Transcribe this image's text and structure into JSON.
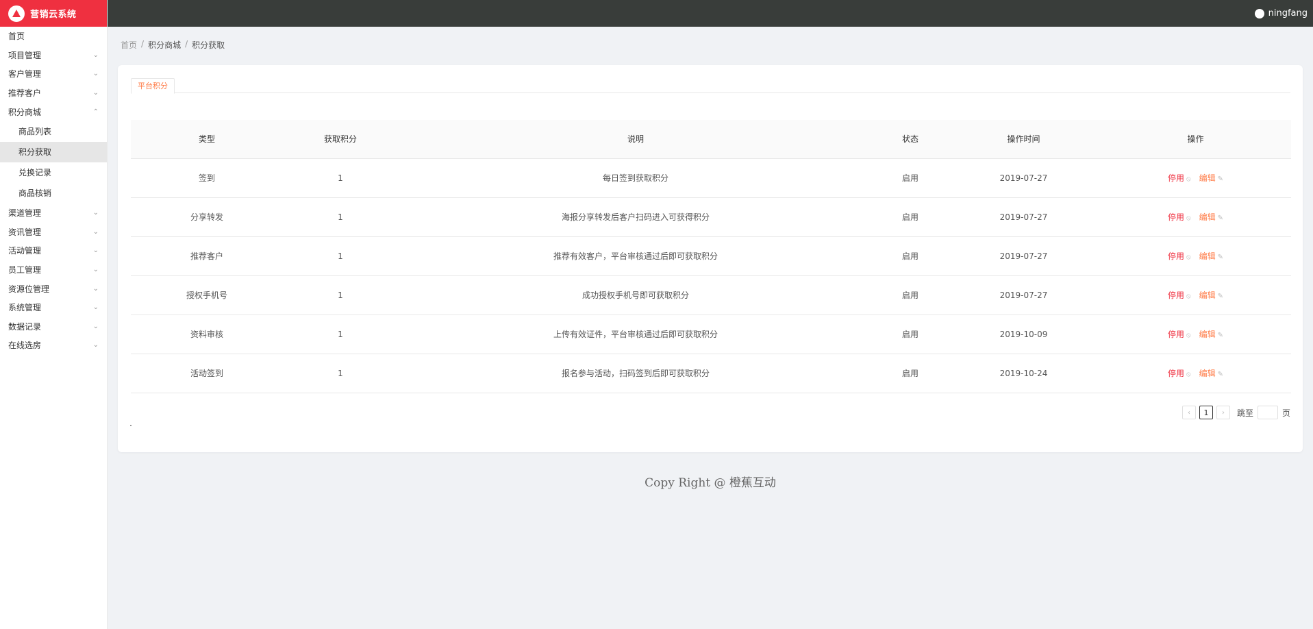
{
  "app": {
    "title": "营销云系统"
  },
  "user": {
    "name": "ningfang"
  },
  "sidebar": {
    "items": [
      {
        "label": "首页",
        "chevron": ""
      },
      {
        "label": "项目管理",
        "chevron": "⌄"
      },
      {
        "label": "客户管理",
        "chevron": "⌄"
      },
      {
        "label": "推荐客户",
        "chevron": "⌄"
      },
      {
        "label": "积分商城",
        "chevron": "⌃"
      }
    ],
    "subitems": [
      {
        "label": "商品列表"
      },
      {
        "label": "积分获取"
      },
      {
        "label": "兑换记录"
      },
      {
        "label": "商品核销"
      }
    ],
    "items_after": [
      {
        "label": "渠道管理",
        "chevron": "⌄"
      },
      {
        "label": "资讯管理",
        "chevron": "⌄"
      },
      {
        "label": "活动管理",
        "chevron": "⌄"
      },
      {
        "label": "员工管理",
        "chevron": "⌄"
      },
      {
        "label": "资源位管理",
        "chevron": "⌄"
      },
      {
        "label": "系统管理",
        "chevron": "⌄"
      },
      {
        "label": "数据记录",
        "chevron": "⌄"
      },
      {
        "label": "在线选房",
        "chevron": "⌄"
      }
    ]
  },
  "breadcrumb": [
    "首页",
    "积分商城",
    "积分获取"
  ],
  "tabs": [
    {
      "label": "平台积分"
    }
  ],
  "table": {
    "headers": [
      "类型",
      "获取积分",
      "说明",
      "状态",
      "操作时间",
      "操作"
    ],
    "rows": [
      {
        "type": "签到",
        "points": "1",
        "desc": "每日签到获取积分",
        "status": "启用",
        "time": "2019-07-27"
      },
      {
        "type": "分享转发",
        "points": "1",
        "desc": "海报分享转发后客户扫码进入可获得积分",
        "status": "启用",
        "time": "2019-07-27"
      },
      {
        "type": "推荐客户",
        "points": "1",
        "desc": "推荐有效客户，平台审核通过后即可获取积分",
        "status": "启用",
        "time": "2019-07-27"
      },
      {
        "type": "授权手机号",
        "points": "1",
        "desc": "成功授权手机号即可获取积分",
        "status": "启用",
        "time": "2019-07-27"
      },
      {
        "type": "资料审核",
        "points": "1",
        "desc": "上传有效证件，平台审核通过后即可获取积分",
        "status": "启用",
        "time": "2019-10-09"
      },
      {
        "type": "活动签到",
        "points": "1",
        "desc": "报名参与活动，扫码签到后即可获取积分",
        "status": "启用",
        "time": "2019-10-24"
      }
    ],
    "action_stop": "停用",
    "action_edit": "编辑"
  },
  "pagination": {
    "prev": "‹",
    "current": "1",
    "next": "›",
    "jump_label": "跳至",
    "page_suffix": "页"
  },
  "footer": {
    "text": "Copy Right @ 橙蕉互动"
  },
  "colors": {
    "brand": "#ef3040",
    "header": "#393d3a",
    "accent": "#ff7a45"
  }
}
